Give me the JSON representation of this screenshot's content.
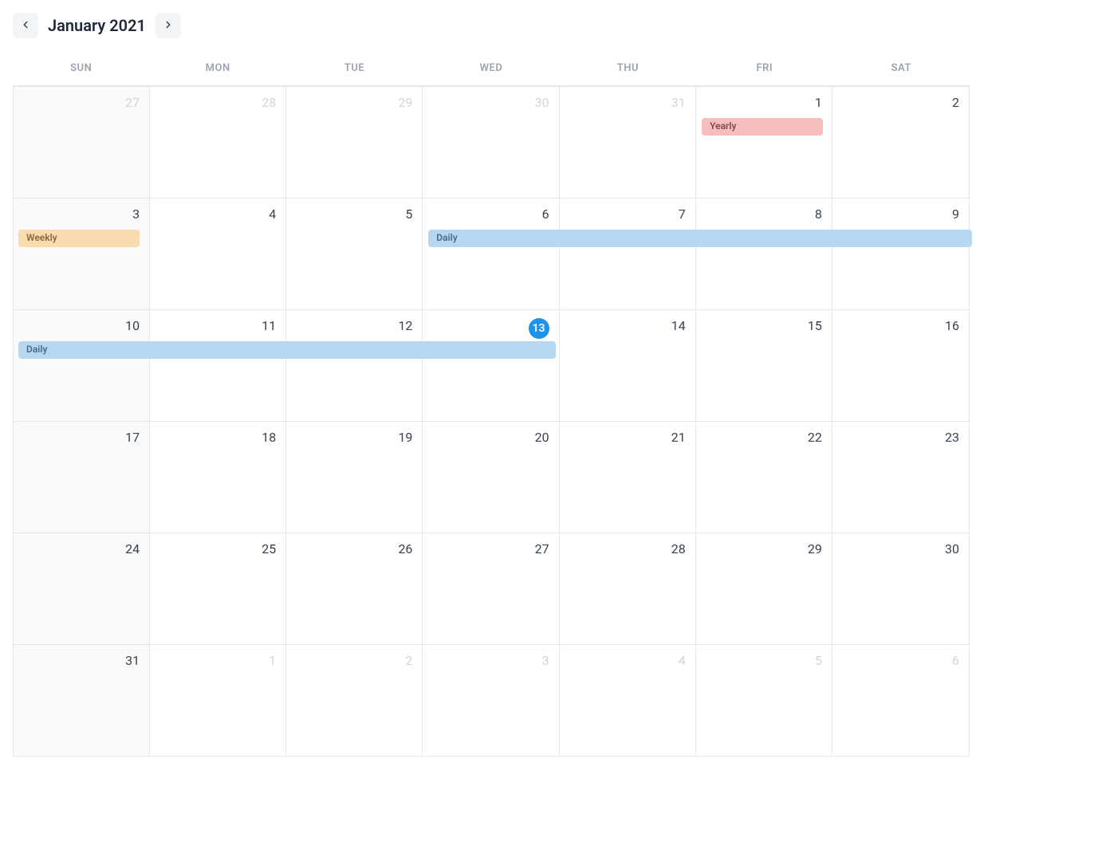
{
  "header": {
    "title": "January 2021"
  },
  "dow": [
    "SUN",
    "MON",
    "TUE",
    "WED",
    "THU",
    "FRI",
    "SAT"
  ],
  "rows": [
    [
      {
        "n": "27",
        "sunday": true,
        "outside": true,
        "today": false
      },
      {
        "n": "28",
        "sunday": false,
        "outside": true,
        "today": false
      },
      {
        "n": "29",
        "sunday": false,
        "outside": true,
        "today": false
      },
      {
        "n": "30",
        "sunday": false,
        "outside": true,
        "today": false
      },
      {
        "n": "31",
        "sunday": false,
        "outside": true,
        "today": false
      },
      {
        "n": "1",
        "sunday": false,
        "outside": false,
        "today": false
      },
      {
        "n": "2",
        "sunday": false,
        "outside": false,
        "today": false
      }
    ],
    [
      {
        "n": "3",
        "sunday": true,
        "outside": false,
        "today": false
      },
      {
        "n": "4",
        "sunday": false,
        "outside": false,
        "today": false
      },
      {
        "n": "5",
        "sunday": false,
        "outside": false,
        "today": false
      },
      {
        "n": "6",
        "sunday": false,
        "outside": false,
        "today": false
      },
      {
        "n": "7",
        "sunday": false,
        "outside": false,
        "today": false
      },
      {
        "n": "8",
        "sunday": false,
        "outside": false,
        "today": false
      },
      {
        "n": "9",
        "sunday": false,
        "outside": false,
        "today": false
      }
    ],
    [
      {
        "n": "10",
        "sunday": true,
        "outside": false,
        "today": false
      },
      {
        "n": "11",
        "sunday": false,
        "outside": false,
        "today": false
      },
      {
        "n": "12",
        "sunday": false,
        "outside": false,
        "today": false
      },
      {
        "n": "13",
        "sunday": false,
        "outside": false,
        "today": true
      },
      {
        "n": "14",
        "sunday": false,
        "outside": false,
        "today": false
      },
      {
        "n": "15",
        "sunday": false,
        "outside": false,
        "today": false
      },
      {
        "n": "16",
        "sunday": false,
        "outside": false,
        "today": false
      }
    ],
    [
      {
        "n": "17",
        "sunday": true,
        "outside": false,
        "today": false
      },
      {
        "n": "18",
        "sunday": false,
        "outside": false,
        "today": false
      },
      {
        "n": "19",
        "sunday": false,
        "outside": false,
        "today": false
      },
      {
        "n": "20",
        "sunday": false,
        "outside": false,
        "today": false
      },
      {
        "n": "21",
        "sunday": false,
        "outside": false,
        "today": false
      },
      {
        "n": "22",
        "sunday": false,
        "outside": false,
        "today": false
      },
      {
        "n": "23",
        "sunday": false,
        "outside": false,
        "today": false
      }
    ],
    [
      {
        "n": "24",
        "sunday": true,
        "outside": false,
        "today": false
      },
      {
        "n": "25",
        "sunday": false,
        "outside": false,
        "today": false
      },
      {
        "n": "26",
        "sunday": false,
        "outside": false,
        "today": false
      },
      {
        "n": "27",
        "sunday": false,
        "outside": false,
        "today": false
      },
      {
        "n": "28",
        "sunday": false,
        "outside": false,
        "today": false
      },
      {
        "n": "29",
        "sunday": false,
        "outside": false,
        "today": false
      },
      {
        "n": "30",
        "sunday": false,
        "outside": false,
        "today": false
      }
    ],
    [
      {
        "n": "31",
        "sunday": true,
        "outside": false,
        "today": false
      },
      {
        "n": "1",
        "sunday": false,
        "outside": true,
        "today": false
      },
      {
        "n": "2",
        "sunday": false,
        "outside": true,
        "today": false
      },
      {
        "n": "3",
        "sunday": false,
        "outside": true,
        "today": false
      },
      {
        "n": "4",
        "sunday": false,
        "outside": true,
        "today": false
      },
      {
        "n": "5",
        "sunday": false,
        "outside": true,
        "today": false
      },
      {
        "n": "6",
        "sunday": false,
        "outside": true,
        "today": false
      }
    ]
  ],
  "events": [
    {
      "label": "Yearly",
      "row": 0,
      "startCol": 5,
      "span": 0.92,
      "color": "pink",
      "insetLeft": 6,
      "insetRight": 0
    },
    {
      "label": "Weekly",
      "row": 1,
      "startCol": 0,
      "span": 0.92,
      "color": "orange",
      "insetLeft": 6,
      "insetRight": 0
    },
    {
      "label": "Daily",
      "row": 1,
      "startCol": 3,
      "span": 4,
      "color": "blue",
      "insetLeft": 6,
      "insetRight": -2
    },
    {
      "label": "Daily",
      "row": 2,
      "startCol": 0,
      "span": 4,
      "color": "blue",
      "insetLeft": 6,
      "insetRight": 6
    }
  ],
  "colors": {
    "pink": "#f6bdbd",
    "orange": "#f8dcaf",
    "blue": "#b7d7f1",
    "today": "#1c93ed"
  }
}
